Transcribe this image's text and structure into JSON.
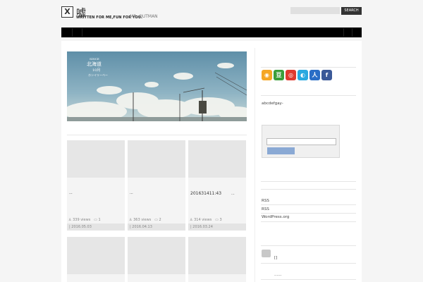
{
  "header": {
    "logo_letter": "X",
    "logo_glyph": "嘘",
    "tagline": "WRITTEN FOR ME,FUN FOR YOU.",
    "author": "-MR. OUTMAN"
  },
  "search": {
    "placeholder": "",
    "button_label": "SEARCH"
  },
  "posts": [
    {
      "title": "...",
      "views": "339 views",
      "comments": "1",
      "date": "| 2016.05.03"
    },
    {
      "title": "...",
      "views": "363 views",
      "comments": "2",
      "date": "| 2016.04.13"
    },
    {
      "title": "201631411:43",
      "extra": "...",
      "views": "314 views",
      "comments": "3",
      "date": "| 2016.03.24"
    }
  ],
  "sidebar": {
    "social_icons": [
      {
        "name": "rss-icon",
        "color": "#f5a623",
        "glyph": "◉"
      },
      {
        "name": "douban-icon",
        "color": "#3a9e3a",
        "glyph": "豆"
      },
      {
        "name": "weibo-icon",
        "color": "#e03a2f",
        "glyph": "◎"
      },
      {
        "name": "tencent-icon",
        "color": "#29a9e0",
        "glyph": "◐"
      },
      {
        "name": "renren-icon",
        "color": "#2a6ec6",
        "glyph": "人"
      },
      {
        "name": "facebook-icon",
        "color": "#3b5998",
        "glyph": "f"
      }
    ],
    "text_widget": "abcdefgay-",
    "links": [
      "RSS",
      "RSS",
      "WordPress.org"
    ],
    "recent_title": "[]",
    "recent_text": "......"
  },
  "colors": {
    "nav": "#000000",
    "accent_button": "#8aa9d4",
    "search_button": "#333333"
  }
}
